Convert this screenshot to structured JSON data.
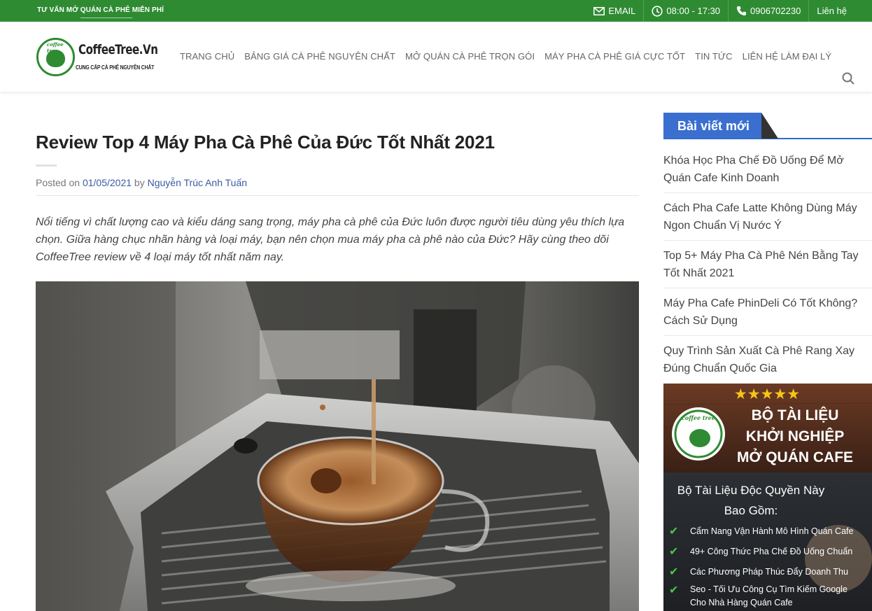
{
  "topbar": {
    "promo": "TƯ VẤN MỞ QUÁN CÀ PHÊ MIỄN PHÍ",
    "email_label": "EMAIL",
    "hours": "08:00 - 17:30",
    "phone": "0906702230",
    "contact": "Liên hệ",
    "background_color": "#2e8b32"
  },
  "header": {
    "logo_name": "CoffeeTree.Vn",
    "logo_tagline": "CUNG CẤP CÀ PHÊ NGUYÊN CHẤT",
    "logo_badge": "coffee tree",
    "nav": [
      "TRANG CHỦ",
      "BẢNG GIÁ CÀ PHÊ NGUYÊN CHẤT",
      "MỞ QUÁN CÀ PHÊ TRỌN GÓI",
      "MÁY PHA CÀ PHÊ GIÁ CỰC TỐT",
      "TIN TỨC",
      "LIÊN HỆ LÀM ĐẠI LÝ"
    ]
  },
  "article": {
    "title": "Review Top 4 Máy Pha Cà Phê Của Đức Tốt Nhất 2021",
    "posted_on": "Posted on",
    "date": "01/05/2021",
    "by": "by",
    "author": "Nguyễn Trúc Anh Tuấn",
    "intro": "Nổi tiếng vì chất lượng cao và kiểu dáng sang trọng, máy pha cà phê của Đức luôn được người tiêu dùng yêu thích lựa chọn. Giữa hàng chục nhãn hàng và loại máy, bạn nên chọn mua máy pha cà phê nào của Đức? Hãy cùng theo dõi CoffeeTree review về 4 loại máy tốt nhất năm nay."
  },
  "sidebar": {
    "widget_title": "Bài viết mới",
    "posts": [
      "Khóa Học Pha Chế Đồ Uống Để Mở Quán Cafe Kinh Doanh",
      "Cách Pha Cafe Latte Không Dùng Máy Ngon Chuẩn Vị Nước Ý",
      "Top 5+ Máy Pha Cà Phê Nén Bằng Tay Tốt Nhất 2021",
      "Máy Pha Cafe PhinDeli Có Tốt Không? Cách Sử Dụng",
      "Quy Trình Sản Xuất Cà Phê Rang Xay Đúng Chuẩn Quốc Gia"
    ],
    "ad": {
      "stars": "★★★★★",
      "headline": [
        "BỘ TÀI LIỆU",
        "KHỞI NGHIỆP",
        "MỞ QUÁN CAFE"
      ],
      "subhead": [
        "Bộ Tài Liệu Độc Quyền Này",
        "Bao Gồm:"
      ],
      "items": [
        "Cẩm Nang Vận Hành Mô Hình Quán Cafe",
        "49+ Công Thức Pha Chế Đồ Uống Chuẩn",
        "Các Phương Pháp Thúc Đẩy Doanh Thu",
        "Seo - Tối Ưu Công Cụ Tìm Kiếm Google",
        "Cho Nhà Hàng Quán Cafe"
      ],
      "badge": "coffee tree"
    }
  },
  "colors": {
    "brand_green": "#2e8b32",
    "widget_blue": "#3a6fd0",
    "link_blue": "#3a5ba0"
  },
  "icons": [
    "envelope-icon",
    "clock-icon",
    "phone-icon",
    "search-icon"
  ]
}
